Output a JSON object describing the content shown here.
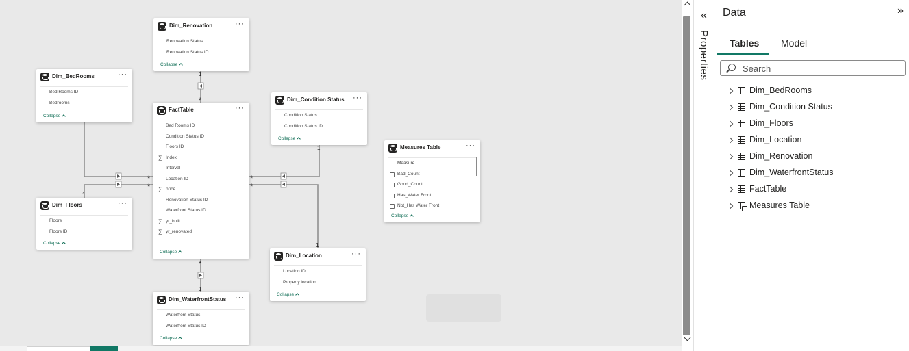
{
  "canvas": {
    "tables": [
      {
        "id": "renovation",
        "title": "Dim_Renovation",
        "fields": [
          {
            "name": "Renovation Status",
            "kind": "plain"
          },
          {
            "name": "Renovation Status ID",
            "kind": "plain"
          }
        ],
        "collapse_label": "Collapse"
      },
      {
        "id": "bedrooms",
        "title": "Dim_BedRooms",
        "fields": [
          {
            "name": "Bed Rooms ID",
            "kind": "plain"
          },
          {
            "name": "Bedrooms",
            "kind": "plain"
          }
        ],
        "collapse_label": "Collapse"
      },
      {
        "id": "fact",
        "title": "FactTable",
        "fields": [
          {
            "name": "Bed Rooms ID",
            "kind": "plain"
          },
          {
            "name": "Condition Status ID",
            "kind": "plain"
          },
          {
            "name": "Floors ID",
            "kind": "plain"
          },
          {
            "name": "Index",
            "kind": "sum"
          },
          {
            "name": "Interval",
            "kind": "plain"
          },
          {
            "name": "Location ID",
            "kind": "plain"
          },
          {
            "name": "price",
            "kind": "sum"
          },
          {
            "name": "Renovation Status ID",
            "kind": "plain"
          },
          {
            "name": "Waterfront Status ID",
            "kind": "plain"
          },
          {
            "name": "yr_built",
            "kind": "sum"
          },
          {
            "name": "yr_renovated",
            "kind": "sum"
          }
        ],
        "collapse_label": "Collapse"
      },
      {
        "id": "condition",
        "title": "Dim_Condition Status",
        "fields": [
          {
            "name": "Condition Status",
            "kind": "plain"
          },
          {
            "name": "Condition Status ID",
            "kind": "plain"
          }
        ],
        "collapse_label": "Collapse"
      },
      {
        "id": "measures",
        "title": "Measures Table",
        "fields": [
          {
            "name": "Measure",
            "kind": "plain"
          },
          {
            "name": "Bad_Count",
            "kind": "calc"
          },
          {
            "name": "Good_Count",
            "kind": "calc"
          },
          {
            "name": "Has_Water Front",
            "kind": "calc"
          },
          {
            "name": "Not_Has Water Front",
            "kind": "calc"
          }
        ],
        "collapse_label": "Collapse"
      },
      {
        "id": "floors",
        "title": "Dim_Floors",
        "fields": [
          {
            "name": "Floors",
            "kind": "plain"
          },
          {
            "name": "Floors ID",
            "kind": "plain"
          }
        ],
        "collapse_label": "Collapse"
      },
      {
        "id": "location",
        "title": "Dim_Location",
        "fields": [
          {
            "name": "Location ID",
            "kind": "plain"
          },
          {
            "name": "Property location",
            "kind": "plain"
          }
        ],
        "collapse_label": "Collapse"
      },
      {
        "id": "waterfront",
        "title": "Dim_WaterfrontStatus",
        "fields": [
          {
            "name": "Waterfront Status",
            "kind": "plain"
          },
          {
            "name": "Waterfront Status ID",
            "kind": "plain"
          }
        ],
        "collapse_label": "Collapse"
      }
    ],
    "relationships": [
      {
        "from": "renovation",
        "to": "fact",
        "one": "1",
        "many": "*"
      },
      {
        "from": "bedrooms",
        "to": "fact",
        "one": "1",
        "many": "*"
      },
      {
        "from": "floors",
        "to": "fact",
        "one": "1",
        "many": "*"
      },
      {
        "from": "condition",
        "to": "fact",
        "one": "1",
        "many": "*"
      },
      {
        "from": "location",
        "to": "fact",
        "one": "1",
        "many": "*"
      },
      {
        "from": "waterfront",
        "to": "fact",
        "one": "1",
        "many": "*"
      }
    ],
    "more_glyph": "···"
  },
  "properties": {
    "label": "Properties",
    "collapse_glyph": "«"
  },
  "data_pane": {
    "title": "Data",
    "expand_glyph": "»",
    "tabs": [
      {
        "label": "Tables",
        "active": true
      },
      {
        "label": "Model",
        "active": false
      }
    ],
    "search": {
      "placeholder": "Search",
      "value": ""
    },
    "tables": [
      {
        "name": "Dim_BedRooms",
        "icon": "table-icon"
      },
      {
        "name": "Dim_Condition Status",
        "icon": "table-icon"
      },
      {
        "name": "Dim_Floors",
        "icon": "table-icon"
      },
      {
        "name": "Dim_Location",
        "icon": "table-icon"
      },
      {
        "name": "Dim_Renovation",
        "icon": "table-icon"
      },
      {
        "name": "Dim_WaterfrontStatus",
        "icon": "table-icon"
      },
      {
        "name": "FactTable",
        "icon": "table-icon"
      },
      {
        "name": "Measures Table",
        "icon": "measures-table-icon"
      }
    ]
  },
  "colors": {
    "accent": "#117865",
    "collapse_link": "#106e56",
    "canvas_bg": "#e9e9e9",
    "relation_line": "#8a8a8a"
  }
}
